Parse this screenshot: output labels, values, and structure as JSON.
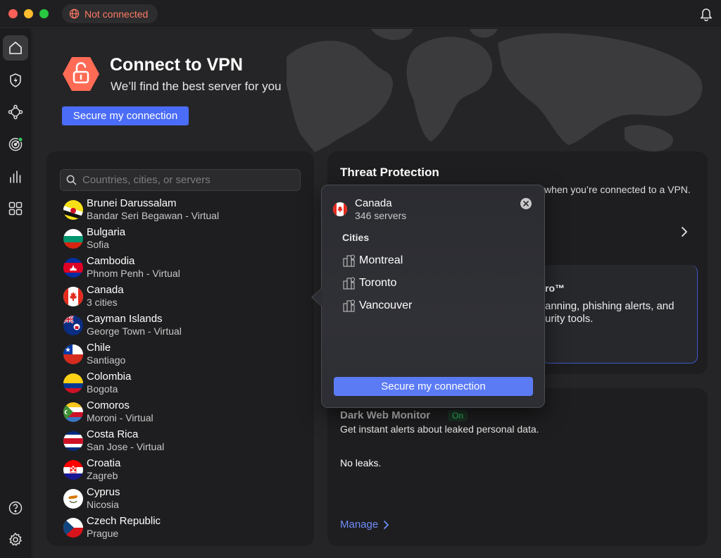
{
  "titlebar": {
    "status": "Not connected",
    "status_color": "#ff7a66"
  },
  "sidebar": {
    "items": [
      {
        "icon": "home-icon",
        "active": true
      },
      {
        "icon": "shield-bolt-icon",
        "active": false
      },
      {
        "icon": "network-nodes-icon",
        "active": false
      },
      {
        "icon": "radar-icon",
        "active": false
      },
      {
        "icon": "bar-chart-icon",
        "active": false
      },
      {
        "icon": "apps-grid-icon",
        "active": false
      }
    ],
    "bottom": [
      {
        "icon": "help-icon"
      },
      {
        "icon": "settings-gear-icon"
      }
    ]
  },
  "hero": {
    "title": "Connect to VPN",
    "subtitle": "We’ll find the best server for you",
    "button": "Secure my connection",
    "accent": "#ff6b55",
    "button_color": "#4a6cf7"
  },
  "search": {
    "placeholder": "Countries, cities, or servers"
  },
  "countries": [
    {
      "name": "Brunei Darussalam",
      "sub": "Bandar Seri Begawan - Virtual"
    },
    {
      "name": "Bulgaria",
      "sub": "Sofia"
    },
    {
      "name": "Cambodia",
      "sub": "Phnom Penh - Virtual"
    },
    {
      "name": "Canada",
      "sub": "3 cities"
    },
    {
      "name": "Cayman Islands",
      "sub": "George Town - Virtual"
    },
    {
      "name": "Chile",
      "sub": "Santiago"
    },
    {
      "name": "Colombia",
      "sub": "Bogota"
    },
    {
      "name": "Comoros",
      "sub": "Moroni - Virtual"
    },
    {
      "name": "Costa Rica",
      "sub": "San Jose - Virtual"
    },
    {
      "name": "Croatia",
      "sub": "Zagreb"
    },
    {
      "name": "Cyprus",
      "sub": "Nicosia"
    },
    {
      "name": "Czech Republic",
      "sub": "Prague"
    }
  ],
  "threat": {
    "title": "Threat Protection",
    "desc": "when you’re connected to a VPN.",
    "promo_title": "ro™",
    "promo_line1": "anning, phishing alerts, and",
    "promo_line2": "urity tools."
  },
  "darkweb": {
    "title": "Dark Web Monitor",
    "badge": "On",
    "desc": "Get instant alerts about leaked personal data.",
    "leaks": "No leaks.",
    "manage": "Manage"
  },
  "popover": {
    "country": "Canada",
    "servers": "346 servers",
    "cities_title": "Cities",
    "cities": [
      "Montreal",
      "Toronto",
      "Vancouver"
    ],
    "button": "Secure my connection",
    "button_color": "#5b7bf5"
  }
}
